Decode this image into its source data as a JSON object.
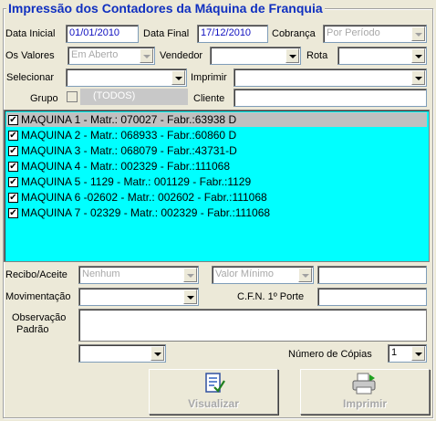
{
  "title": "Impressão dos Contadores da Máquina de Franquia",
  "row1": {
    "data_inicial_label": "Data Inicial",
    "data_inicial_value": "01/01/2010",
    "data_final_label": "Data Final",
    "data_final_value": "17/12/2010",
    "cobranca_label": "Cobrança",
    "cobranca_value": "Por Período"
  },
  "row2": {
    "os_valores_label": "Os Valores",
    "os_valores_value": "Em Aberto",
    "vendedor_label": "Vendedor",
    "vendedor_value": "",
    "rota_label": "Rota",
    "rota_value": ""
  },
  "row3": {
    "selecionar_label": "Selecionar",
    "selecionar_value": "",
    "imprimir_label": "Imprimir",
    "imprimir_value": ""
  },
  "row4": {
    "grupo_label": "Grupo",
    "grupo_value": "(TODOS)",
    "cliente_label": "Cliente",
    "cliente_value": ""
  },
  "machines": [
    {
      "label": "MAQUINA 1 - Matr.: 070027 - Fabr.:63938 D",
      "checked": true,
      "selected": true
    },
    {
      "label": "MAQUINA 2 - Matr.: 068933 - Fabr.:60860 D",
      "checked": true,
      "selected": false
    },
    {
      "label": "MAQUINA 3 - Matr.: 068079 - Fabr.:43731-D",
      "checked": true,
      "selected": false
    },
    {
      "label": "MAQUINA 4 - Matr.: 002329 - Fabr.:111068",
      "checked": true,
      "selected": false
    },
    {
      "label": "MAQUINA 5 - 1129 - Matr.: 001129 - Fabr.:1129",
      "checked": true,
      "selected": false
    },
    {
      "label": "MAQUINA 6 -02602 - Matr.: 002602 - Fabr.:111068",
      "checked": true,
      "selected": false
    },
    {
      "label": "MAQUINA 7 - 02329 - Matr.: 002329 - Fabr.:111068",
      "checked": true,
      "selected": false
    }
  ],
  "bottom": {
    "recibo_label": "Recibo/Aceite",
    "recibo_value": "Nenhum",
    "valor_value": "Valor Mínimo",
    "valor_input": "",
    "movimentacao_label": "Movimentação",
    "movimentacao_value": "",
    "cfn_label": "C.F.N. 1º Porte",
    "cfn_value": "",
    "observacao_label_1": "Observação",
    "observacao_label_2": "Padrão",
    "observacao_value": "",
    "extra_combo_value": "",
    "copias_label": "Número de Cópias",
    "copias_value": "1"
  },
  "buttons": {
    "visualizar_label": "Visualizar",
    "visualizar_icon": "report-preview-icon",
    "imprimir_label": "Imprimir",
    "imprimir_icon": "printer-icon"
  },
  "colors": {
    "title": "#1030c0",
    "list_background": "#00ffff",
    "list_selected": "#c0c0c0",
    "date_text": "#1010c0"
  }
}
